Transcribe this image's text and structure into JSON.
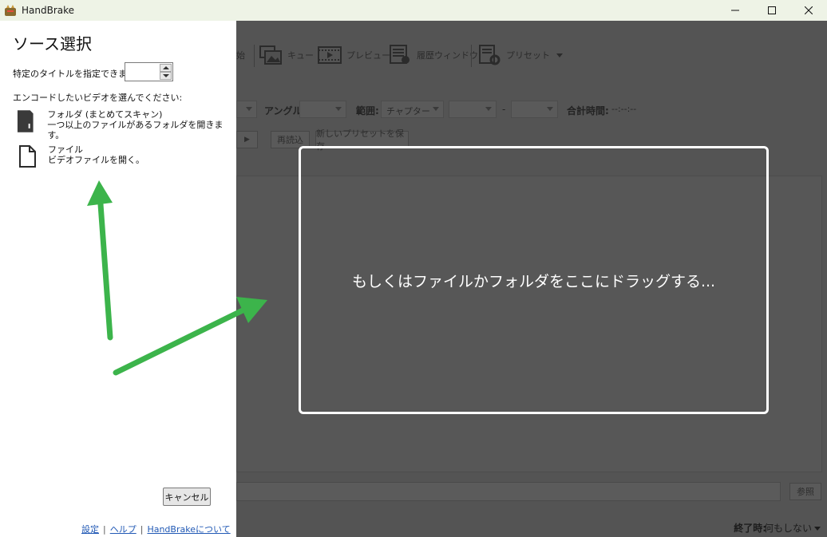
{
  "window": {
    "title": "HandBrake",
    "controls": [
      "minimize",
      "maximize",
      "close"
    ]
  },
  "toolbar": {
    "start_partial": "始",
    "queue_label": "キュー",
    "preview_label": "プレビュー",
    "activity_label": "履歴ウィンドウ",
    "presets_label": "プリセット"
  },
  "source_row": {
    "angle_label": "アングル:",
    "range_label": "範囲:",
    "range_value": "チャプター",
    "range_dash": "-",
    "duration_label": "合計時間:",
    "duration_value": "--:--:--"
  },
  "preset_row": {
    "play_glyph": "▶",
    "reload_label": "再読込",
    "save_preset_label": "新しいプリセットを保存"
  },
  "destination": {
    "browse_label": "参照"
  },
  "status": {
    "when_done_label": "終了時:",
    "when_done_value": "何もしない"
  },
  "dropzone": {
    "text": "もしくはファイルかフォルダをここにドラッグする..."
  },
  "source_pane": {
    "title": "ソース選択",
    "title_picker_label": "特定のタイトルを指定できます:",
    "title_picker_value": "",
    "choose_label": "エンコードしたいビデオを選んでください:",
    "options": [
      {
        "title": "フォルダ (まとめてスキャン)",
        "desc": "一つ以上のファイルがあるフォルダを開きます。"
      },
      {
        "title": "ファイル",
        "desc": "ビデオファイルを開く。"
      }
    ],
    "cancel_label": "キャンセル",
    "links": {
      "settings": "設定",
      "help": "ヘルプ",
      "about": "HandBrakeについて",
      "separator": "|"
    }
  },
  "colors": {
    "arrow": "#3cb44b",
    "overlay": "#545454",
    "link": "#2159b5"
  }
}
